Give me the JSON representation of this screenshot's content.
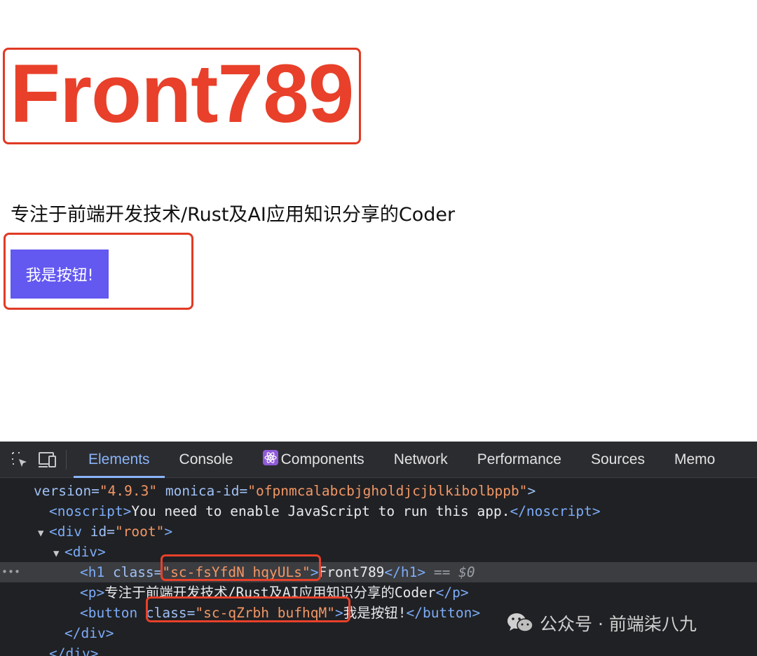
{
  "page": {
    "title": "Front789",
    "description": "专注于前端开发技术/Rust及AI应用知识分享的Coder",
    "button_label": "我是按钮!"
  },
  "devtools": {
    "tabs": [
      {
        "label": "Elements",
        "active": true
      },
      {
        "label": "Console",
        "active": false
      },
      {
        "label": "Components",
        "active": false,
        "icon": "react-icon"
      },
      {
        "label": "Network",
        "active": false
      },
      {
        "label": "Performance",
        "active": false
      },
      {
        "label": "Sources",
        "active": false
      },
      {
        "label": "Memo",
        "active": false
      }
    ],
    "tree": {
      "line1_attr_version": "version=",
      "line1_val_version": "\"4.9.3\"",
      "line1_attr_monica": "monica-id=",
      "line1_val_monica": "\"ofpnmcalabcbjgholdjcjblkibolbppb\"",
      "noscript_text": "You need to enable JavaScript to run this app.",
      "div_root_id": "\"root\"",
      "h1_class": "\"sc-fsYfdN hqyULs\"",
      "h1_text": "Front789",
      "selected_marker": "== $0",
      "p_text": "专注于前端开发技术/Rust及AI应用知识分享的Coder",
      "button_class": "\"sc-qZrbh bufhqM\"",
      "button_text": "我是按钮!"
    }
  },
  "watermark": {
    "text": "公众号 · 前端柒八九",
    "icon": "wechat-icon"
  },
  "colors": {
    "title_red": "#e8402a",
    "highlight_red": "#e03a24",
    "button_purple": "#6358f0",
    "devtools_bg": "#202124",
    "active_tab_blue": "#8ab4f8"
  }
}
